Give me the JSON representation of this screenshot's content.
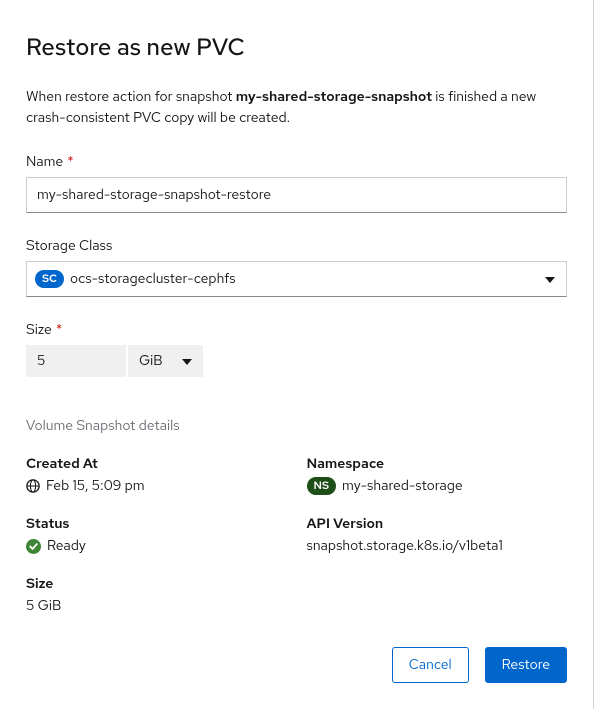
{
  "modal": {
    "title": "Restore as new PVC",
    "description_prefix": "When restore action for snapshot ",
    "snapshot_name": "my-shared-storage-snapshot",
    "description_suffix": " is finished a new crash-consistent PVC copy will be created."
  },
  "form": {
    "name_label": "Name",
    "name_value": "my-shared-storage-snapshot-restore",
    "storage_class_label": "Storage Class",
    "storage_class_badge": "SC",
    "storage_class_value": "ocs-storagecluster-cephfs",
    "size_label": "Size",
    "size_value": "5",
    "size_unit": "GiB"
  },
  "details": {
    "section_title": "Volume Snapshot details",
    "created_at_label": "Created At",
    "created_at_value": "Feb 15, 5:09 pm",
    "namespace_label": "Namespace",
    "namespace_badge": "NS",
    "namespace_value": "my-shared-storage",
    "status_label": "Status",
    "status_value": "Ready",
    "api_version_label": "API Version",
    "api_version_value": "snapshot.storage.k8s.io/v1beta1",
    "size_label": "Size",
    "size_value": "5 GiB"
  },
  "footer": {
    "cancel_label": "Cancel",
    "restore_label": "Restore"
  }
}
